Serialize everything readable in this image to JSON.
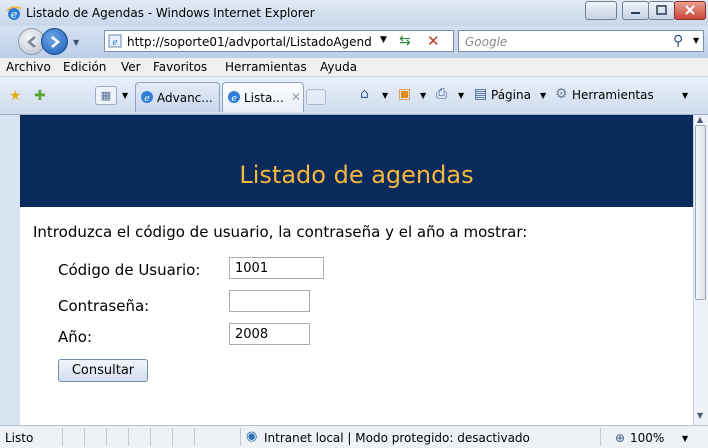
{
  "window": {
    "title": "Listado de Agendas - Windows Internet Explorer"
  },
  "address_bar": {
    "url": "http://soporte01/advportal/ListadoAgend",
    "search_placeholder": "Google"
  },
  "menu": {
    "items": [
      "Archivo",
      "Edición",
      "Ver",
      "Favoritos",
      "Herramientas",
      "Ayuda"
    ]
  },
  "tabs": [
    {
      "label": "Advanc..."
    },
    {
      "label": "Lista..."
    }
  ],
  "commands": {
    "page_label": "Página",
    "tools_label": "Herramientas"
  },
  "page": {
    "heading": "Listado de agendas",
    "instructions": "Introduzca el código de usuario, la contraseña y el año a mostrar:",
    "fields": {
      "user_label": "Código de Usuario:",
      "user_value": "1001",
      "password_label": "Contraseña:",
      "password_value": "",
      "year_label": "Año:",
      "year_value": "2008"
    },
    "submit_label": "Consultar"
  },
  "status_bar": {
    "status": "Listo",
    "zone": "Intranet local | Modo protegido: desactivado",
    "zoom": "100%"
  },
  "colors": {
    "header_bg": "#0b2a5c",
    "header_text": "#f6b83b"
  }
}
